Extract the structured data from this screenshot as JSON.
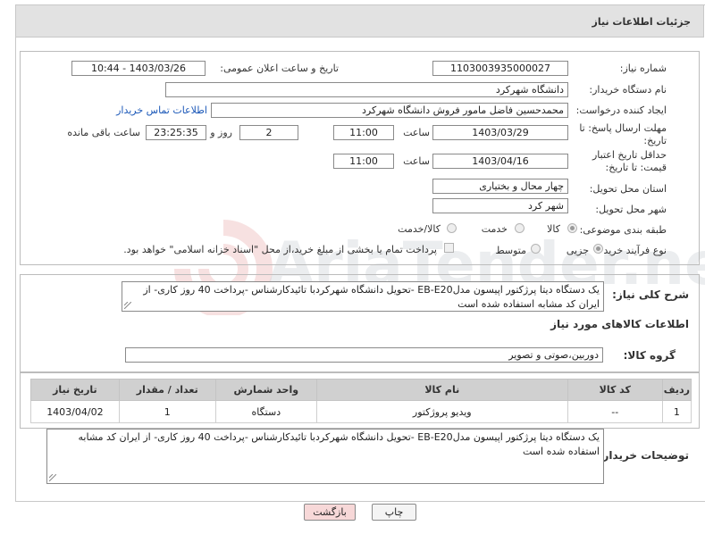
{
  "header": {
    "title": "جزئیات اطلاعات نیاز"
  },
  "form": {
    "need_number": {
      "label": "شماره نیاز:",
      "value": "1103003935000027"
    },
    "announce_datetime": {
      "label": "تاریخ و ساعت اعلان عمومی:",
      "value": "1403/03/26 - 10:44"
    },
    "buyer_org": {
      "label": "نام دستگاه خریدار:",
      "value": "دانشگاه شهرکرد"
    },
    "requester": {
      "label": "ایجاد کننده درخواست:",
      "value": "محمدحسین فاضل مامور فروش دانشگاه شهرکرد",
      "contact_link": "اطلاعات تماس خریدار"
    },
    "reply_deadline": {
      "label": "مهلت ارسال پاسخ: تا تاریخ:",
      "date": "1403/03/29",
      "time_label": "ساعت",
      "time": "11:00",
      "days": "2",
      "days_label": "روز و",
      "remaining": "23:25:35",
      "remaining_label": "ساعت باقی مانده"
    },
    "price_validity": {
      "label": "حداقل تاریخ اعتبار قیمت: تا تاریخ:",
      "date": "1403/04/16",
      "time_label": "ساعت",
      "time": "11:00"
    },
    "province": {
      "label": "استان محل تحویل:",
      "value": "چهار محال و بختیاری"
    },
    "city": {
      "label": "شهر محل تحویل:",
      "value": "شهر کرد"
    },
    "category": {
      "label": "طبقه بندی موضوعی:",
      "options": [
        "کالا",
        "خدمت",
        "کالا/خدمت"
      ],
      "selected": "کالا"
    },
    "purchase_type": {
      "label": "نوع فرآیند خرید :",
      "options": [
        "جزیی",
        "متوسط"
      ],
      "selected": "جزیی",
      "payment_note": "پرداخت تمام یا بخشی از مبلغ خرید،از محل \"اسناد خزانه اسلامی\" خواهد بود."
    }
  },
  "description": {
    "label": "شرح کلی نیاز:",
    "value": "یک دستگاه دیتا پرژکتور اپیسون مدلEB-E20 -تحویل دانشگاه شهرکردبا تائیدکارشناس -پرداخت 40 روز کاری- از ایران کد مشابه استفاده شده است"
  },
  "goods_section": {
    "title": "اطلاعات کالاهای مورد نیاز",
    "group_label": "گروه کالا:",
    "group_value": "دوربین،صوتی و تصویر"
  },
  "goods_table": {
    "headers": [
      "ردیف",
      "کد کالا",
      "نام کالا",
      "واحد شمارش",
      "تعداد / مقدار",
      "تاریخ نیاز"
    ],
    "rows": [
      [
        "1",
        "--",
        "ویدیو پروژکتور",
        "دستگاه",
        "1",
        "1403/04/02"
      ]
    ]
  },
  "buyer_notes": {
    "label": "توضیحات خریدار:",
    "value": "یک دستگاه دیتا پرژکتور اپیسون مدلEB-E20 -تحویل دانشگاه شهرکردبا تائیدکارشناس -پرداخت 40 روز کاری- از ایران کد مشابه استفاده شده است"
  },
  "buttons": {
    "print": "چاپ",
    "back": "بازگشت"
  },
  "watermark": {
    "text": "AriaTender.neT"
  },
  "colors": {
    "header_bg": "#e2e2e2",
    "table_header_bg": "#d0d0d0",
    "link": "#1b58b8",
    "back_button_bg": "#f7d8d8"
  }
}
